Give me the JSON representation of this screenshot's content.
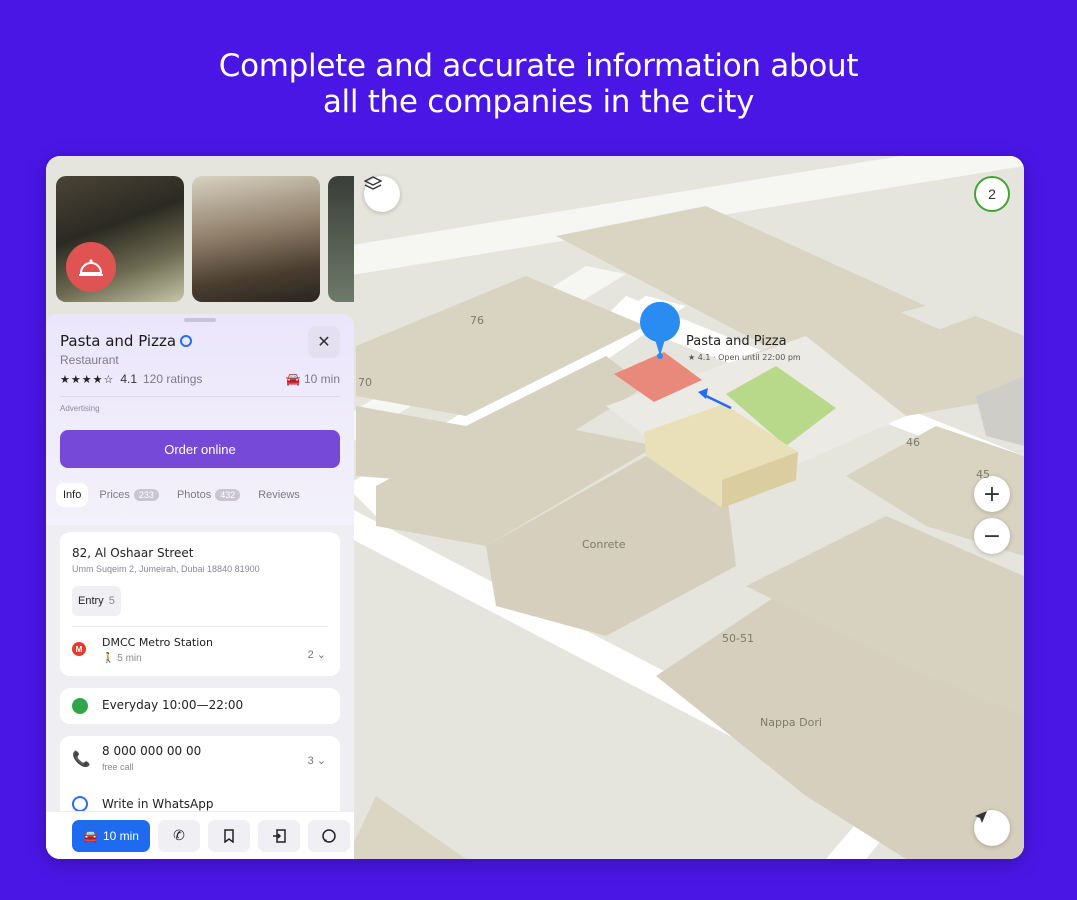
{
  "headline": {
    "line1": "Complete and accurate information about",
    "line2": "all the companies in the city"
  },
  "map": {
    "layers_icon": "layers-icon",
    "badge_count": "2",
    "zoom_in": "+",
    "zoom_out": "−",
    "labels": [
      "76",
      "70",
      "46",
      "45",
      "Conrete",
      "50-51",
      "Nappa Dori"
    ],
    "poi": {
      "name": "Pasta and Pizza",
      "sub": "★ 4.1 · Open until 22:00 pm"
    }
  },
  "card": {
    "title": "Pasta and Pizza",
    "category": "Restaurant",
    "stars": "★★★★☆",
    "rating": "4.1",
    "ratings_count": "120 ratings",
    "drive_time": "10 min",
    "advertising": "Advertising",
    "order_label": "Order online",
    "tabs": [
      {
        "label": "Info",
        "count": ""
      },
      {
        "label": "Prices",
        "count": "233"
      },
      {
        "label": "Photos",
        "count": "432"
      },
      {
        "label": "Reviews",
        "count": ""
      }
    ]
  },
  "info": {
    "address": "82, Al Oshaar Street",
    "address_sub": "Umm Suqeim 2, Jumeirah, Dubai 18840 81900",
    "entry_label": "Entry",
    "entry_count": "5",
    "metro": "DMCC Metro Station",
    "metro_sub": "5 min",
    "metro_count": "2",
    "hours": "Everyday 10:00—22:00",
    "phone": "8 000 000 00 00",
    "phone_sub": "free call",
    "phone_count": "3",
    "whatsapp": "Write in WhatsApp"
  },
  "bottom_bar": {
    "route_label": "10 min"
  }
}
